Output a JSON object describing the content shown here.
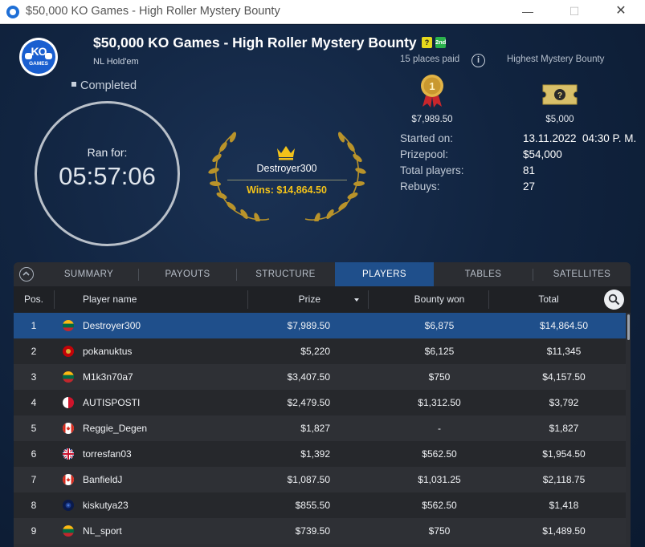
{
  "window": {
    "title": "$50,000 KO Games - High Roller Mystery Bounty"
  },
  "header": {
    "logo_text": "KO",
    "logo_sub": "GAMES",
    "title": "$50,000 KO Games - High Roller Mystery Bounty",
    "badges": [
      "?",
      "2nd"
    ],
    "game_type": "NL Hold'em",
    "status": "Completed",
    "timer_label": "Ran for:",
    "timer_value": "05:57:06",
    "winner": {
      "name": "Destroyer300",
      "wins": "Wins: $14,864.50"
    }
  },
  "summary": {
    "places_paid": "15 places paid",
    "highest_bounty_label": "Highest Mystery Bounty",
    "first_prize": "$7,989.50",
    "highest_bounty": "$5,000",
    "started_label": "Started on:",
    "started_date": "13.11.2022",
    "started_time": "04:30 P. M.",
    "prizepool_label": "Prizepool:",
    "prizepool": "$54,000",
    "players_label": "Total players:",
    "players": "81",
    "rebuys_label": "Rebuys:",
    "rebuys": "27"
  },
  "tabs": [
    "SUMMARY",
    "PAYOUTS",
    "STRUCTURE",
    "PLAYERS",
    "TABLES",
    "SATELLITES"
  ],
  "active_tab": "PLAYERS",
  "table": {
    "headers": {
      "pos": "Pos.",
      "name": "Player name",
      "prize": "Prize",
      "bounty": "Bounty won",
      "total": "Total"
    },
    "sort_column": "Prize",
    "rows": [
      {
        "pos": "1",
        "flag": "lithuania",
        "name": "Destroyer300",
        "prize": "$7,989.50",
        "bounty": "$6,875",
        "total": "$14,864.50",
        "selected": true
      },
      {
        "pos": "2",
        "flag": "montenegro",
        "name": "pokanuktus",
        "prize": "$5,220",
        "bounty": "$6,125",
        "total": "$11,345"
      },
      {
        "pos": "3",
        "flag": "lithuania",
        "name": "M1k3n70a7",
        "prize": "$3,407.50",
        "bounty": "$750",
        "total": "$4,157.50"
      },
      {
        "pos": "4",
        "flag": "malta",
        "name": "AUTISPOSTI",
        "prize": "$2,479.50",
        "bounty": "$1,312.50",
        "total": "$3,792"
      },
      {
        "pos": "5",
        "flag": "canada",
        "name": "Reggie_Degen",
        "prize": "$1,827",
        "bounty": "-",
        "total": "$1,827"
      },
      {
        "pos": "6",
        "flag": "united-kingdom",
        "name": "torresfan03",
        "prize": "$1,392",
        "bounty": "$562.50",
        "total": "$1,954.50"
      },
      {
        "pos": "7",
        "flag": "canada",
        "name": "BanfieldJ",
        "prize": "$1,087.50",
        "bounty": "$1,031.25",
        "total": "$2,118.75"
      },
      {
        "pos": "8",
        "flag": "hidden",
        "name": "kiskutya23",
        "prize": "$855.50",
        "bounty": "$562.50",
        "total": "$1,418"
      },
      {
        "pos": "9",
        "flag": "lithuania",
        "name": "NL_sport",
        "prize": "$739.50",
        "bounty": "$750",
        "total": "$1,489.50"
      }
    ]
  },
  "colors": {
    "accent": "#1f4f8b",
    "gold": "#f2c21a",
    "background": "#0f1d33"
  }
}
